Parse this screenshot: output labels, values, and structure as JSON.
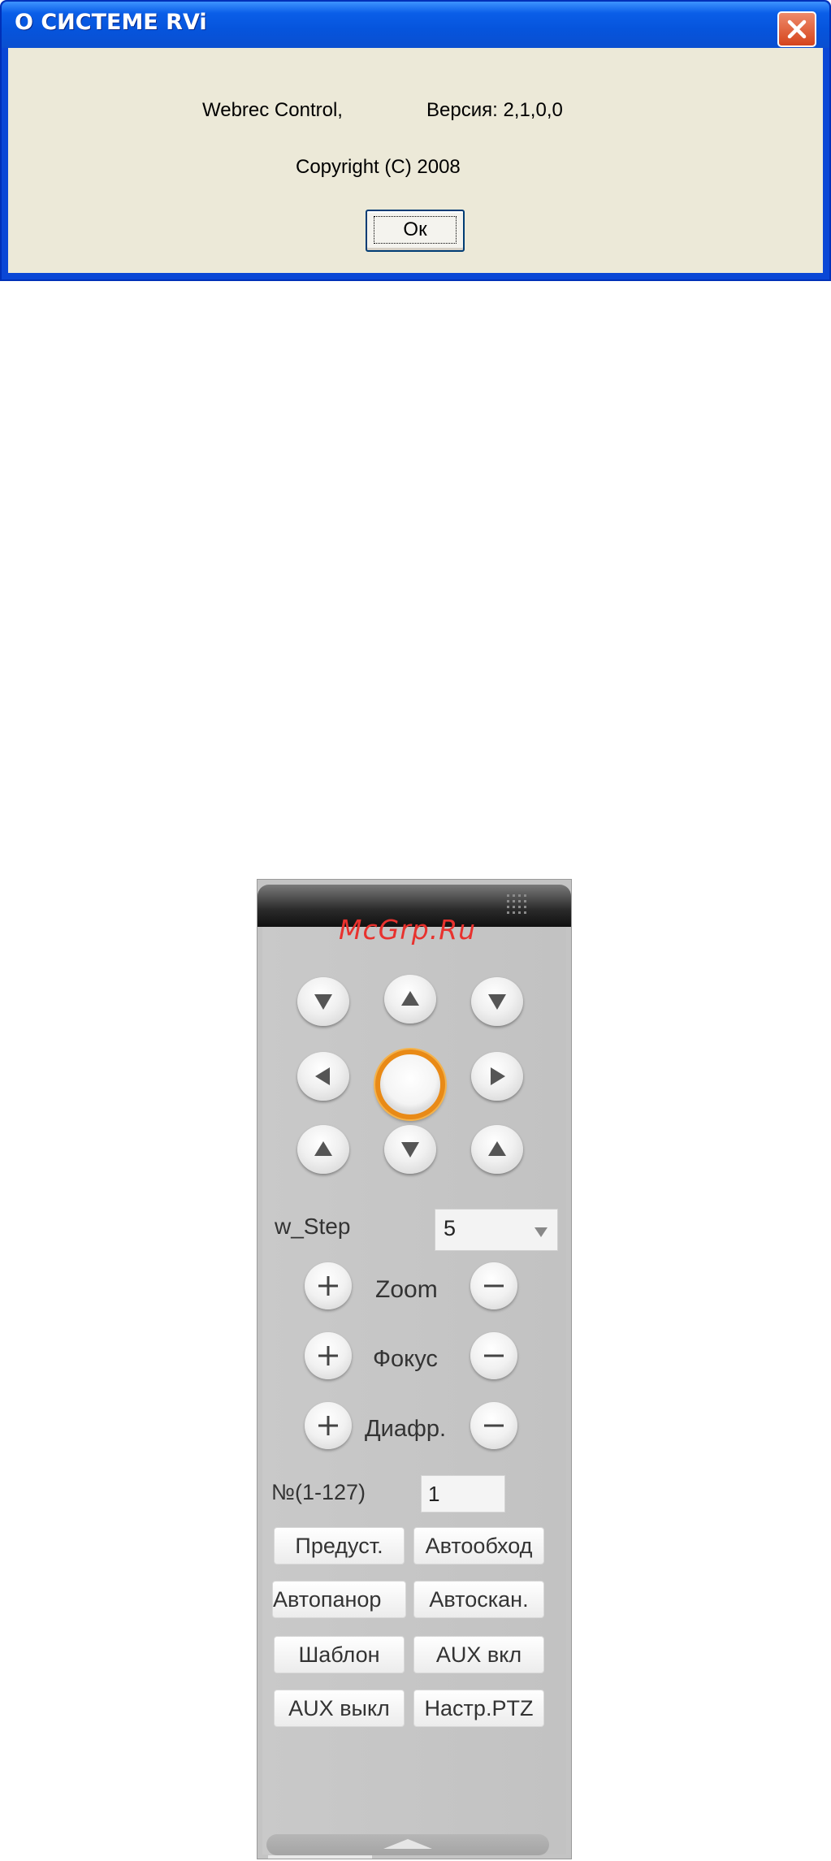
{
  "dialog": {
    "title": "О СИСТЕМЕ RVi",
    "product": "Webrec Control,",
    "version": "Версия: 2,1,0,0",
    "copyright": "Copyright (C) 2008",
    "ok_label": "Ок"
  },
  "ptz": {
    "watermark": "McGrp.Ru",
    "step_label": "w_Step",
    "step_value": "5",
    "zoom_label": "Zoom",
    "focus_label": "Фокус",
    "iris_label": "Диафр.",
    "number_label": "№(1-127)",
    "number_value": "1",
    "buttons": {
      "preset": "Предуст.",
      "tour": "Автообход",
      "pan": "Автопанор",
      "scan": "Автоскан.",
      "pattern": "Шаблон",
      "aux_on": "AUX вкл",
      "aux_off": "AUX выкл",
      "ptz_setup": "Настр.PTZ"
    }
  },
  "colors": {
    "titlebar": "#0a5ee8",
    "dialog_body": "#ece9d8",
    "panel": "#c4c4c4",
    "center_ring": "#e98a16",
    "watermark": "#e8322e"
  }
}
